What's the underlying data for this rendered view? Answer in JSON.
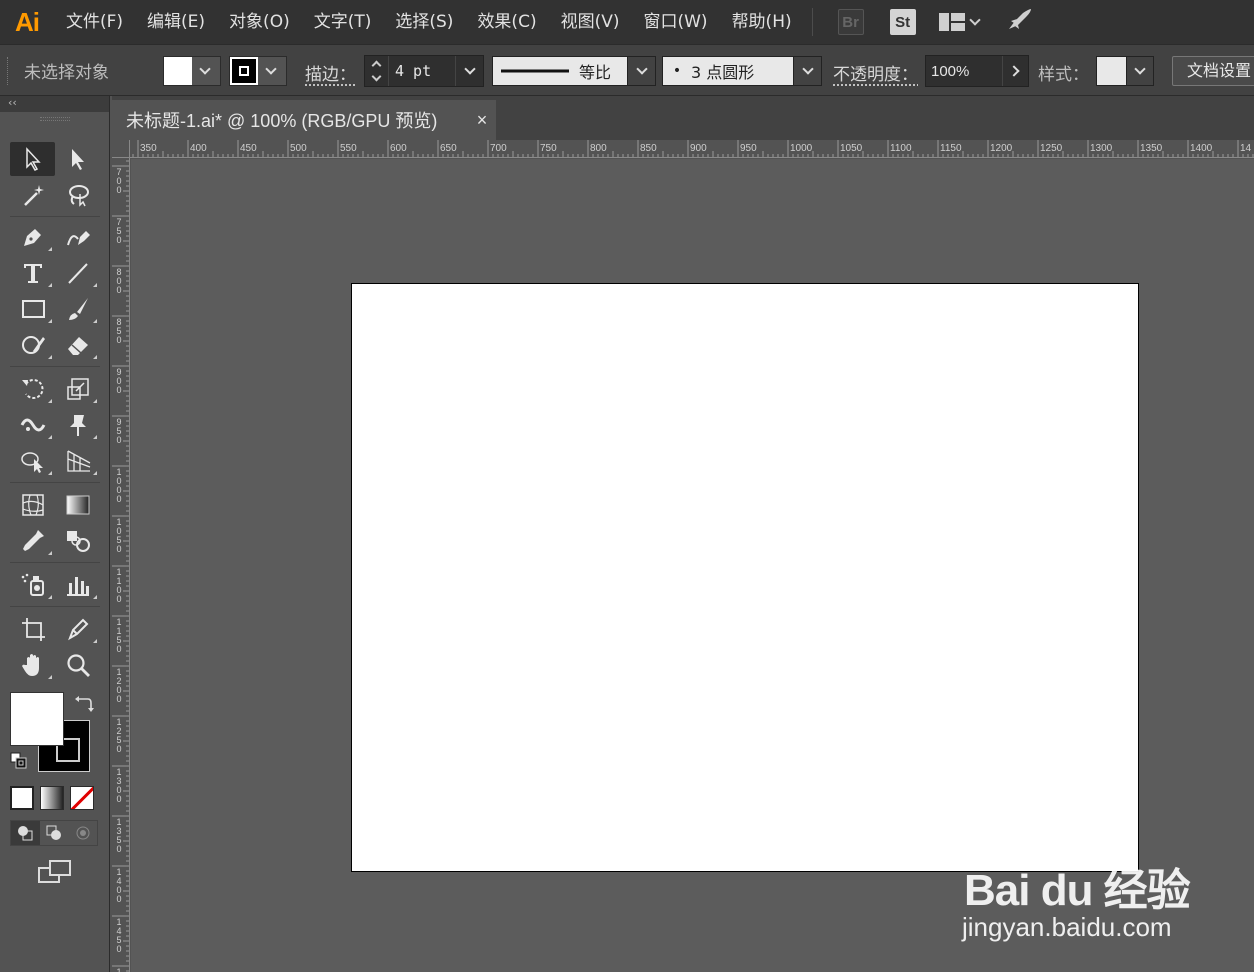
{
  "menubar": {
    "logo": "Ai",
    "items": [
      "文件(F)",
      "编辑(E)",
      "对象(O)",
      "文字(T)",
      "选择(S)",
      "效果(C)",
      "视图(V)",
      "窗口(W)",
      "帮助(H)"
    ],
    "bridge_badge": "Br",
    "stock_badge": "St"
  },
  "controlbar": {
    "status": "未选择对象",
    "stroke_label": "描边：",
    "stroke_weight": "4 pt",
    "profile_label": "等比",
    "brush_label": "3 点圆形",
    "opacity_label": "不透明度：",
    "opacity_value": "100%",
    "style_label": "样式：",
    "doc_setup_button": "文档设置"
  },
  "toolpanel": {
    "collapse_label": "‹‹"
  },
  "document": {
    "tab_title": "未标题-1.ai* @ 100% (RGB/GPU 预览)",
    "tab_close": "×"
  },
  "rulers": {
    "horizontal": [
      "350",
      "400",
      "450",
      "500",
      "550",
      "600",
      "650",
      "700",
      "750",
      "800",
      "850",
      "900",
      "950",
      "1000",
      "1050",
      "1100",
      "1150",
      "1200",
      "1250",
      "1300",
      "1350",
      "1400",
      "14"
    ],
    "vertical": [
      "700",
      "750",
      "800",
      "850",
      "900",
      "950",
      "1000",
      "1050",
      "1100",
      "1150",
      "1200",
      "1250",
      "1300",
      "1350",
      "1400",
      "1450",
      "1"
    ]
  },
  "watermark": {
    "brand": "Bai du 经验",
    "url": "jingyan.baidu.com"
  },
  "colors": {
    "accent_ai": "#ff9a00",
    "fill": "#ffffff",
    "stroke": "#000000",
    "canvas": "#5c5c5c",
    "artboard": "#ffffff"
  }
}
